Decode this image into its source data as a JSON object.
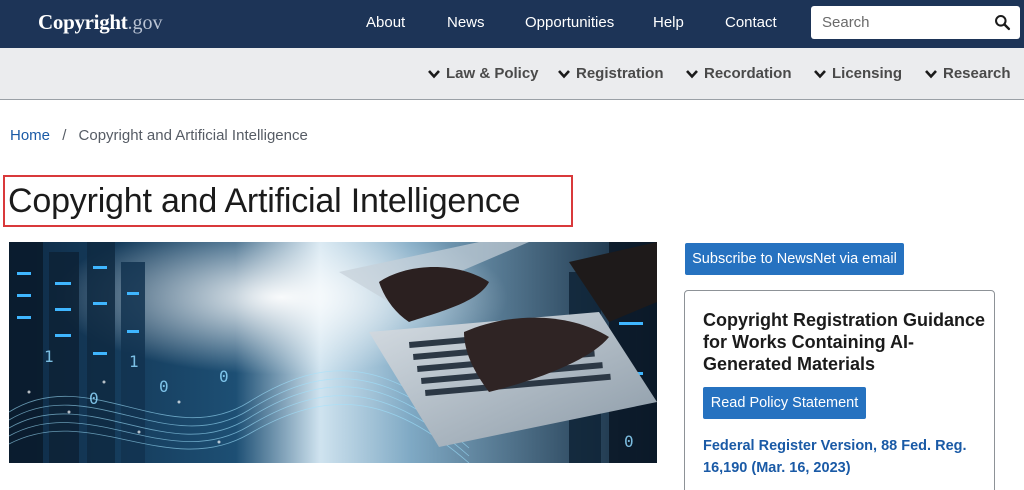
{
  "logo": {
    "main": "Copyright",
    "ext": ".gov"
  },
  "top_nav": {
    "items": [
      "About",
      "News",
      "Opportunities",
      "Help",
      "Contact"
    ]
  },
  "search": {
    "placeholder": "Search",
    "icon": "search-icon"
  },
  "sub_nav": {
    "items": [
      "Law & Policy",
      "Registration",
      "Recordation",
      "Licensing",
      "Research"
    ],
    "icon": "chevron-down-icon"
  },
  "breadcrumb": {
    "home": "Home",
    "separator": "/",
    "current": "Copyright and Artificial Intelligence"
  },
  "page": {
    "title": "Copyright and Artificial Intelligence"
  },
  "sidebar": {
    "subscribe_label": "Subscribe to NewsNet via email",
    "card": {
      "heading": "Copyright Registration Guidance for Works Containing AI-Generated Materials",
      "button_label": "Read Policy Statement",
      "link_text": "Federal Register Version, 88 Fed. Reg. 16,190 (Mar. 16, 2023)"
    }
  },
  "colors": {
    "nav_bg": "#1d3457",
    "subnav_bg": "#ebecee",
    "button_bg": "#2672c0",
    "link": "#1a5aa6",
    "title_highlight": "#d9393b"
  }
}
